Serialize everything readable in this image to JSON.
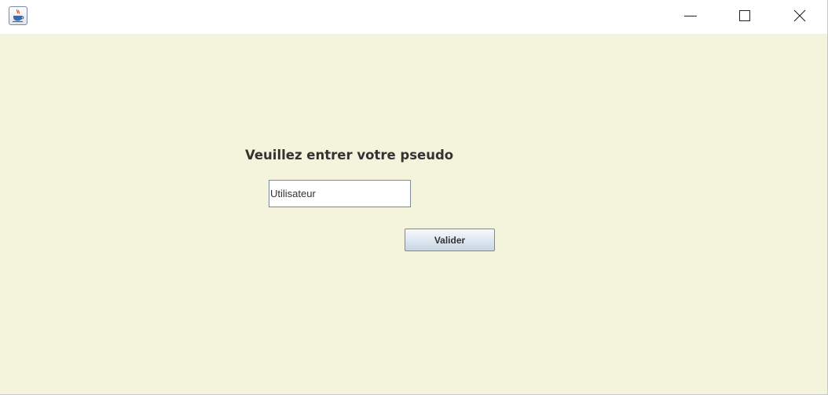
{
  "window": {
    "title": "",
    "icon": "java-cup-icon",
    "controls": {
      "minimize_icon": "minimize-icon",
      "maximize_icon": "maximize-icon",
      "close_icon": "close-icon"
    }
  },
  "form": {
    "prompt": "Veuillez entrer votre pseudo",
    "pseudo_value": "Utilisateur",
    "submit_label": "Valider"
  },
  "colors": {
    "background": "#f4f4dc",
    "text": "#333333"
  }
}
